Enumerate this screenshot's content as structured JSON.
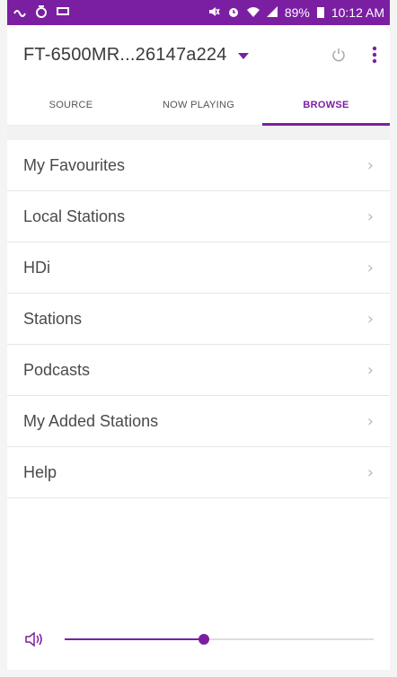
{
  "status_bar": {
    "battery_text": "89%",
    "time": "10:12 AM",
    "left_icons": [
      "signal-wave-icon",
      "app-notification-icon",
      "message-icon"
    ],
    "right_icons": [
      "mute-icon",
      "alarm-icon",
      "wifi-icon",
      "cellular-signal-icon",
      "battery-icon"
    ]
  },
  "header": {
    "device_name": "FT-6500MR...26147a224",
    "icons": [
      "dropdown-caret-icon",
      "power-icon",
      "more-vert-icon"
    ]
  },
  "tabs": [
    {
      "label": "SOURCE",
      "active": false
    },
    {
      "label": "NOW PLAYING",
      "active": false
    },
    {
      "label": "BROWSE",
      "active": true
    }
  ],
  "browse_list": [
    {
      "label": "My Favourites"
    },
    {
      "label": "Local Stations"
    },
    {
      "label": "HDi"
    },
    {
      "label": "Stations"
    },
    {
      "label": "Podcasts"
    },
    {
      "label": "My Added Stations"
    },
    {
      "label": "Help"
    }
  ],
  "chevron_glyph": "›",
  "volume": {
    "level_percent": 45,
    "icon": "speaker-volume-icon"
  },
  "colors": {
    "accent": "#7b1fa2",
    "status_bar": "#7b1fa2",
    "text": "#4a4a4a",
    "divider": "#e6e6e6",
    "chevron": "#b8b8b8"
  }
}
